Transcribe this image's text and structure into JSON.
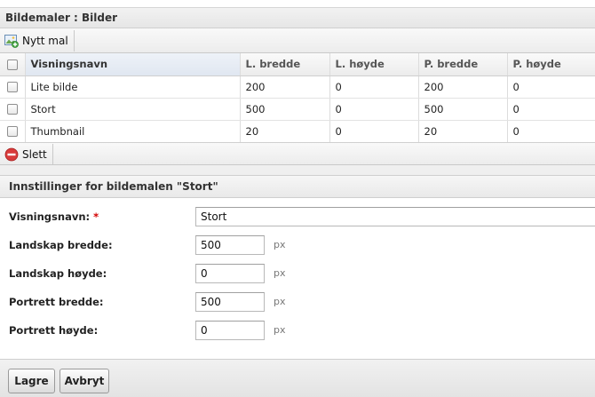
{
  "title": "Bildemaler : Bilder",
  "toolbar": {
    "new_label": "Nytt mal"
  },
  "table": {
    "columns": [
      "Visningsnavn",
      "L. bredde",
      "L. høyde",
      "P. bredde",
      "P. høyde"
    ],
    "rows": [
      [
        "Lite bilde",
        "200",
        "0",
        "200",
        "0"
      ],
      [
        "Stort",
        "500",
        "0",
        "500",
        "0"
      ],
      [
        "Thumbnail",
        "20",
        "0",
        "20",
        "0"
      ]
    ]
  },
  "toolbar2": {
    "delete_label": "Slett"
  },
  "section": {
    "title": "Innstillinger for bildemalen \"Stort\""
  },
  "form": {
    "display_name_label": "Visningsnavn:",
    "required_mark": "*",
    "display_name_value": "Stort",
    "landscape_width_label": "Landskap bredde:",
    "landscape_width_value": "500",
    "landscape_height_label": "Landskap høyde:",
    "landscape_height_value": "0",
    "portrait_width_label": "Portrett bredde:",
    "portrait_width_value": "500",
    "portrait_height_label": "Portrett høyde:",
    "portrait_height_value": "0",
    "unit": "px"
  },
  "footer": {
    "save_label": "Lagre",
    "cancel_label": "Avbryt"
  },
  "colors": {
    "required": "#d20000",
    "delete_icon": "#d93b3b",
    "new_icon": "#3fa33f"
  },
  "icons": {
    "new": "image-add-icon",
    "delete": "delete-icon"
  }
}
